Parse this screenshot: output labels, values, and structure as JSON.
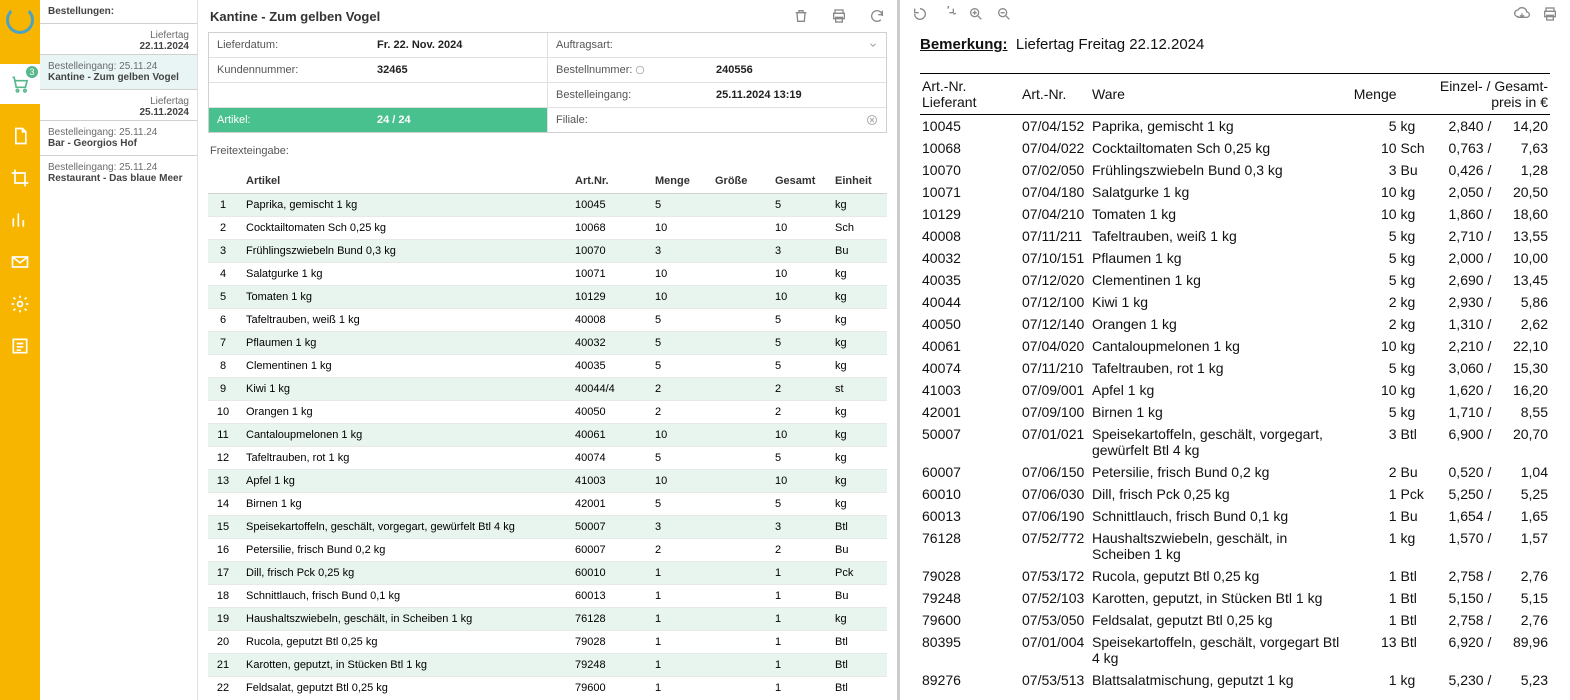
{
  "rail": {
    "cart_badge": "3"
  },
  "orders": {
    "header": "Bestellungen:",
    "groups": [
      {
        "label": "Liefertag",
        "date": "22.11.2024",
        "items": [
          {
            "line1": "Bestelleingang: 25.11.24",
            "line2": "Kantine - Zum gelben Vogel",
            "active": true
          }
        ]
      },
      {
        "label": "Liefertag",
        "date": "25.11.2024",
        "items": [
          {
            "line1": "Bestelleingang: 25.11.24",
            "line2": "Bar - Georgios Hof"
          },
          {
            "line1": "Bestelleingang: 25.11.24",
            "line2": "Restaurant - Das blaue Meer"
          }
        ]
      }
    ]
  },
  "mid": {
    "title": "Kantine - Zum gelben Vogel",
    "info": {
      "lieferdatum_lbl": "Lieferdatum:",
      "lieferdatum": "Fr. 22. Nov. 2024",
      "auftragsart_lbl": "Auftragsart:",
      "auftragsart": "",
      "kundennr_lbl": "Kundennummer:",
      "kundennr": "32465",
      "bestellnr_lbl": "Bestellnummer:",
      "bestellnr": "240556",
      "bestelleingang_lbl": "Bestelleingang:",
      "bestelleingang": "25.11.2024 13:19",
      "artikel_lbl": "Artikel:",
      "artikel": "24 / 24",
      "filiale_lbl": "Filiale:",
      "filiale": ""
    },
    "freitext_lbl": "Freitexteingabe:",
    "cols": {
      "idx": "",
      "artikel": "Artikel",
      "artnr": "Art.Nr.",
      "menge": "Menge",
      "groesse": "Größe",
      "gesamt": "Gesamt",
      "einheit": "Einheit"
    },
    "rows": [
      {
        "n": "1",
        "art": "Paprika, gemischt 1 kg",
        "nr": "10045",
        "m": "5",
        "g": "",
        "t": "5",
        "e": "kg"
      },
      {
        "n": "2",
        "art": "Cocktailtomaten Sch 0,25 kg",
        "nr": "10068",
        "m": "10",
        "g": "",
        "t": "10",
        "e": "Sch"
      },
      {
        "n": "3",
        "art": "Frühlingszwiebeln Bund 0,3 kg",
        "nr": "10070",
        "m": "3",
        "g": "",
        "t": "3",
        "e": "Bu"
      },
      {
        "n": "4",
        "art": "Salatgurke 1 kg",
        "nr": "10071",
        "m": "10",
        "g": "",
        "t": "10",
        "e": "kg"
      },
      {
        "n": "5",
        "art": "Tomaten 1 kg",
        "nr": "10129",
        "m": "10",
        "g": "",
        "t": "10",
        "e": "kg"
      },
      {
        "n": "6",
        "art": "Tafeltrauben, weiß 1 kg",
        "nr": "40008",
        "m": "5",
        "g": "",
        "t": "5",
        "e": "kg"
      },
      {
        "n": "7",
        "art": "Pflaumen 1 kg",
        "nr": "40032",
        "m": "5",
        "g": "",
        "t": "5",
        "e": "kg"
      },
      {
        "n": "8",
        "art": "Clementinen 1 kg",
        "nr": "40035",
        "m": "5",
        "g": "",
        "t": "5",
        "e": "kg"
      },
      {
        "n": "9",
        "art": "Kiwi 1 kg",
        "nr": "40044/4",
        "m": "2",
        "g": "",
        "t": "2",
        "e": "st"
      },
      {
        "n": "10",
        "art": "Orangen 1 kg",
        "nr": "40050",
        "m": "2",
        "g": "",
        "t": "2",
        "e": "kg"
      },
      {
        "n": "11",
        "art": "Cantaloupmelonen 1 kg",
        "nr": "40061",
        "m": "10",
        "g": "",
        "t": "10",
        "e": "kg"
      },
      {
        "n": "12",
        "art": "Tafeltrauben, rot 1 kg",
        "nr": "40074",
        "m": "5",
        "g": "",
        "t": "5",
        "e": "kg"
      },
      {
        "n": "13",
        "art": "Apfel 1 kg",
        "nr": "41003",
        "m": "10",
        "g": "",
        "t": "10",
        "e": "kg"
      },
      {
        "n": "14",
        "art": "Birnen 1 kg",
        "nr": "42001",
        "m": "5",
        "g": "",
        "t": "5",
        "e": "kg"
      },
      {
        "n": "15",
        "art": "Speisekartoffeln, geschält, vorgegart, gewürfelt Btl 4 kg",
        "nr": "50007",
        "m": "3",
        "g": "",
        "t": "3",
        "e": "Btl"
      },
      {
        "n": "16",
        "art": "Petersilie, frisch Bund 0,2 kg",
        "nr": "60007",
        "m": "2",
        "g": "",
        "t": "2",
        "e": "Bu"
      },
      {
        "n": "17",
        "art": "Dill, frisch Pck 0,25 kg",
        "nr": "60010",
        "m": "1",
        "g": "",
        "t": "1",
        "e": "Pck"
      },
      {
        "n": "18",
        "art": "Schnittlauch, frisch Bund 0,1 kg",
        "nr": "60013",
        "m": "1",
        "g": "",
        "t": "1",
        "e": "Bu"
      },
      {
        "n": "19",
        "art": "Haushaltszwiebeln, geschält, in Scheiben 1 kg",
        "nr": "76128",
        "m": "1",
        "g": "",
        "t": "1",
        "e": "kg"
      },
      {
        "n": "20",
        "art": "Rucola, geputzt Btl 0,25 kg",
        "nr": "79028",
        "m": "1",
        "g": "",
        "t": "1",
        "e": "Btl"
      },
      {
        "n": "21",
        "art": "Karotten, geputzt, in Stücken Btl 1 kg",
        "nr": "79248",
        "m": "1",
        "g": "",
        "t": "1",
        "e": "Btl"
      },
      {
        "n": "22",
        "art": "Feldsalat, geputzt Btl 0,25 kg",
        "nr": "79600",
        "m": "1",
        "g": "",
        "t": "1",
        "e": "Btl"
      }
    ]
  },
  "doc": {
    "remark_lbl": "Bemerkung:",
    "remark_val": "Liefertag Freitag 22.12.2024",
    "cols": {
      "a": "Art.-Nr. Lieferant",
      "b": "Art.-Nr.",
      "c": "Ware",
      "d": "Menge",
      "e": "Einzel- / Gesamt-\npreis in €"
    },
    "rows": [
      {
        "a": "10045",
        "b": "07/04/152",
        "c": "Paprika, gemischt  1 kg",
        "m": "5",
        "u": "kg",
        "p": "2,840  /",
        "t": "14,20"
      },
      {
        "a": "10068",
        "b": "07/04/022",
        "c": "Cocktailtomaten  Sch 0,25 kg",
        "m": "10",
        "u": "Sch",
        "p": "0,763  /",
        "t": "7,63"
      },
      {
        "a": "10070",
        "b": "07/02/050",
        "c": "Frühlingszwiebeln  Bund 0,3 kg",
        "m": "3",
        "u": "Bu",
        "p": "0,426  /",
        "t": "1,28"
      },
      {
        "a": "10071",
        "b": "07/04/180",
        "c": "Salatgurke  1 kg",
        "m": "10",
        "u": "kg",
        "p": "2,050  /",
        "t": "20,50"
      },
      {
        "a": "10129",
        "b": "07/04/210",
        "c": "Tomaten  1 kg",
        "m": "10",
        "u": "kg",
        "p": "1,860  /",
        "t": "18,60"
      },
      {
        "a": "40008",
        "b": "07/11/211",
        "c": "Tafeltrauben, weiß  1 kg",
        "m": "5",
        "u": "kg",
        "p": "2,710  /",
        "t": "13,55"
      },
      {
        "a": "40032",
        "b": "07/10/151",
        "c": "Pflaumen  1 kg",
        "m": "5",
        "u": "kg",
        "p": "2,000  /",
        "t": "10,00"
      },
      {
        "a": "40035",
        "b": "07/12/020",
        "c": "Clementinen  1 kg",
        "m": "5",
        "u": "kg",
        "p": "2,690  /",
        "t": "13,45"
      },
      {
        "a": "40044",
        "b": "07/12/100",
        "c": "Kiwi  1 kg",
        "m": "2",
        "u": "kg",
        "p": "2,930  /",
        "t": "5,86"
      },
      {
        "a": "40050",
        "b": "07/12/140",
        "c": "Orangen  1 kg",
        "m": "2",
        "u": "kg",
        "p": "1,310  /",
        "t": "2,62"
      },
      {
        "a": "40061",
        "b": "07/04/020",
        "c": "Cantaloupmelonen  1 kg",
        "m": "10",
        "u": "kg",
        "p": "2,210  /",
        "t": "22,10"
      },
      {
        "a": "40074",
        "b": "07/11/210",
        "c": "Tafeltrauben, rot 1 kg",
        "m": "5",
        "u": "kg",
        "p": "3,060  /",
        "t": "15,30"
      },
      {
        "a": "41003",
        "b": "07/09/001",
        "c": "Apfel  1 kg",
        "m": "10",
        "u": "kg",
        "p": "1,620  /",
        "t": "16,20"
      },
      {
        "a": "42001",
        "b": "07/09/100",
        "c": "Birnen  1 kg",
        "m": "5",
        "u": "kg",
        "p": "1,710  /",
        "t": "8,55"
      },
      {
        "a": "50007",
        "b": "07/01/021",
        "c": "Speisekartoffeln, geschält, vorgegart, gewürfelt Btl 4 kg",
        "m": "3",
        "u": "Btl",
        "p": "6,900  /",
        "t": "20,70"
      },
      {
        "a": "60007",
        "b": "07/06/150",
        "c": "Petersilie, frisch  Bund 0,2 kg",
        "m": "2",
        "u": "Bu",
        "p": "0,520  /",
        "t": "1,04"
      },
      {
        "a": "60010",
        "b": "07/06/030",
        "c": "Dill, frisch  Pck 0,25 kg",
        "m": "1",
        "u": "Pck",
        "p": "5,250  /",
        "t": "5,25"
      },
      {
        "a": "60013",
        "b": "07/06/190",
        "c": "Schnittlauch, frisch  Bund 0,1 kg",
        "m": "1",
        "u": "Bu",
        "p": "1,654  /",
        "t": "1,65"
      },
      {
        "a": "76128",
        "b": "07/52/772",
        "c": "Haushaltszwiebeln, geschält, in Scheiben  1 kg",
        "m": "1",
        "u": "kg",
        "p": "1,570  /",
        "t": "1,57"
      },
      {
        "a": "79028",
        "b": "07/53/172",
        "c": "Rucola, geputzt  Btl 0,25 kg",
        "m": "1",
        "u": "Btl",
        "p": "2,758  /",
        "t": "2,76"
      },
      {
        "a": "79248",
        "b": "07/52/103",
        "c": "Karotten, geputzt, in Stücken Btl 1 kg",
        "m": "1",
        "u": "Btl",
        "p": "5,150  /",
        "t": "5,15"
      },
      {
        "a": "79600",
        "b": "07/53/050",
        "c": "Feldsalat, geputzt  Btl 0,25 kg",
        "m": "1",
        "u": "Btl",
        "p": "2,758  /",
        "t": "2,76"
      },
      {
        "a": "80395",
        "b": "07/01/004",
        "c": "Speisekartoffeln, geschält, vorgegart  Btl 4 kg",
        "m": "13",
        "u": "Btl",
        "p": "6,920  /",
        "t": "89,96"
      },
      {
        "a": "89276",
        "b": "07/53/513",
        "c": "Blattsalatmischung, geputzt  1 kg",
        "m": "1",
        "u": "kg",
        "p": "5,230  /",
        "t": "5,23"
      }
    ]
  }
}
